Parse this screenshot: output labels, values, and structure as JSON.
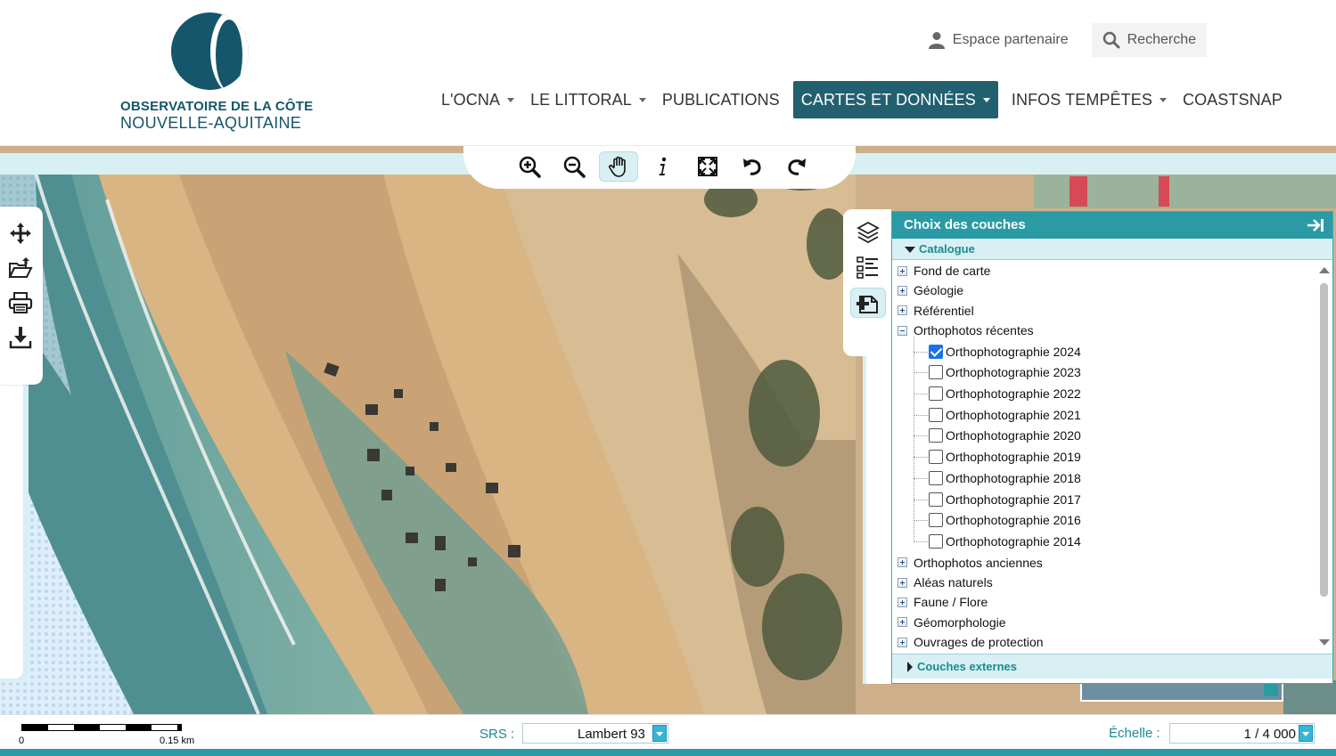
{
  "brand": {
    "line1": "OBSERVATOIRE DE LA CÔTE",
    "line2": "NOUVELLE-AQUITAINE",
    "primary_color": "#15566b",
    "accent_color": "#2a9ba5"
  },
  "top_links": {
    "partner": {
      "label": "Espace partenaire",
      "icon": "user-icon"
    },
    "search": {
      "label": "Recherche",
      "icon": "search-icon"
    }
  },
  "nav": {
    "items": [
      {
        "label": "L'OCNA",
        "dropdown": true,
        "active": false
      },
      {
        "label": "LE LITTORAL",
        "dropdown": true,
        "active": false
      },
      {
        "label": "PUBLICATIONS",
        "dropdown": false,
        "active": false
      },
      {
        "label": "CARTES ET DONNÉES",
        "dropdown": true,
        "active": true
      },
      {
        "label": "INFOS TEMPÊTES",
        "dropdown": true,
        "active": false
      },
      {
        "label": "COASTSNAP",
        "dropdown": false,
        "active": false
      }
    ]
  },
  "map_tools": [
    "zoom-in-icon",
    "zoom-out-icon",
    "pan-hand-icon",
    "info-icon",
    "full-extent-icon",
    "undo-icon",
    "redo-icon"
  ],
  "active_tool": "pan-hand-icon",
  "left_tools": [
    "move-icon",
    "open-folder-icon",
    "print-icon",
    "download-icon"
  ],
  "layers_panel": {
    "title": "Choix des couches",
    "catalogue_label": "Catalogue",
    "external_label": "Couches externes",
    "groups_top": [
      {
        "label": "Fond de carte",
        "expanded": false
      },
      {
        "label": "Géologie",
        "expanded": false
      },
      {
        "label": "Référentiel",
        "expanded": false
      },
      {
        "label": "Orthophotos récentes",
        "expanded": true
      }
    ],
    "ortho_layers": [
      {
        "label": "Orthophotographie 2024",
        "checked": true
      },
      {
        "label": "Orthophotographie 2023",
        "checked": false
      },
      {
        "label": "Orthophotographie 2022",
        "checked": false
      },
      {
        "label": "Orthophotographie 2021",
        "checked": false
      },
      {
        "label": "Orthophotographie 2020",
        "checked": false
      },
      {
        "label": "Orthophotographie 2019",
        "checked": false
      },
      {
        "label": "Orthophotographie 2018",
        "checked": false
      },
      {
        "label": "Orthophotographie 2017",
        "checked": false
      },
      {
        "label": "Orthophotographie 2016",
        "checked": false
      },
      {
        "label": "Orthophotographie 2014",
        "checked": false
      }
    ],
    "groups_bottom": [
      {
        "label": "Orthophotos anciennes",
        "expanded": false
      },
      {
        "label": "Aléas naturels",
        "expanded": false
      },
      {
        "label": "Faune / Flore",
        "expanded": false
      },
      {
        "label": "Géomorphologie",
        "expanded": false
      },
      {
        "label": "Ouvrages de protection",
        "expanded": false
      }
    ]
  },
  "footer": {
    "scale_start": "0",
    "scale_end": "0.15 km",
    "srs_label": "SRS :",
    "srs_value": "Lambert 93",
    "scale_label": "Échelle :",
    "scale_value": "1 / 4 000"
  }
}
